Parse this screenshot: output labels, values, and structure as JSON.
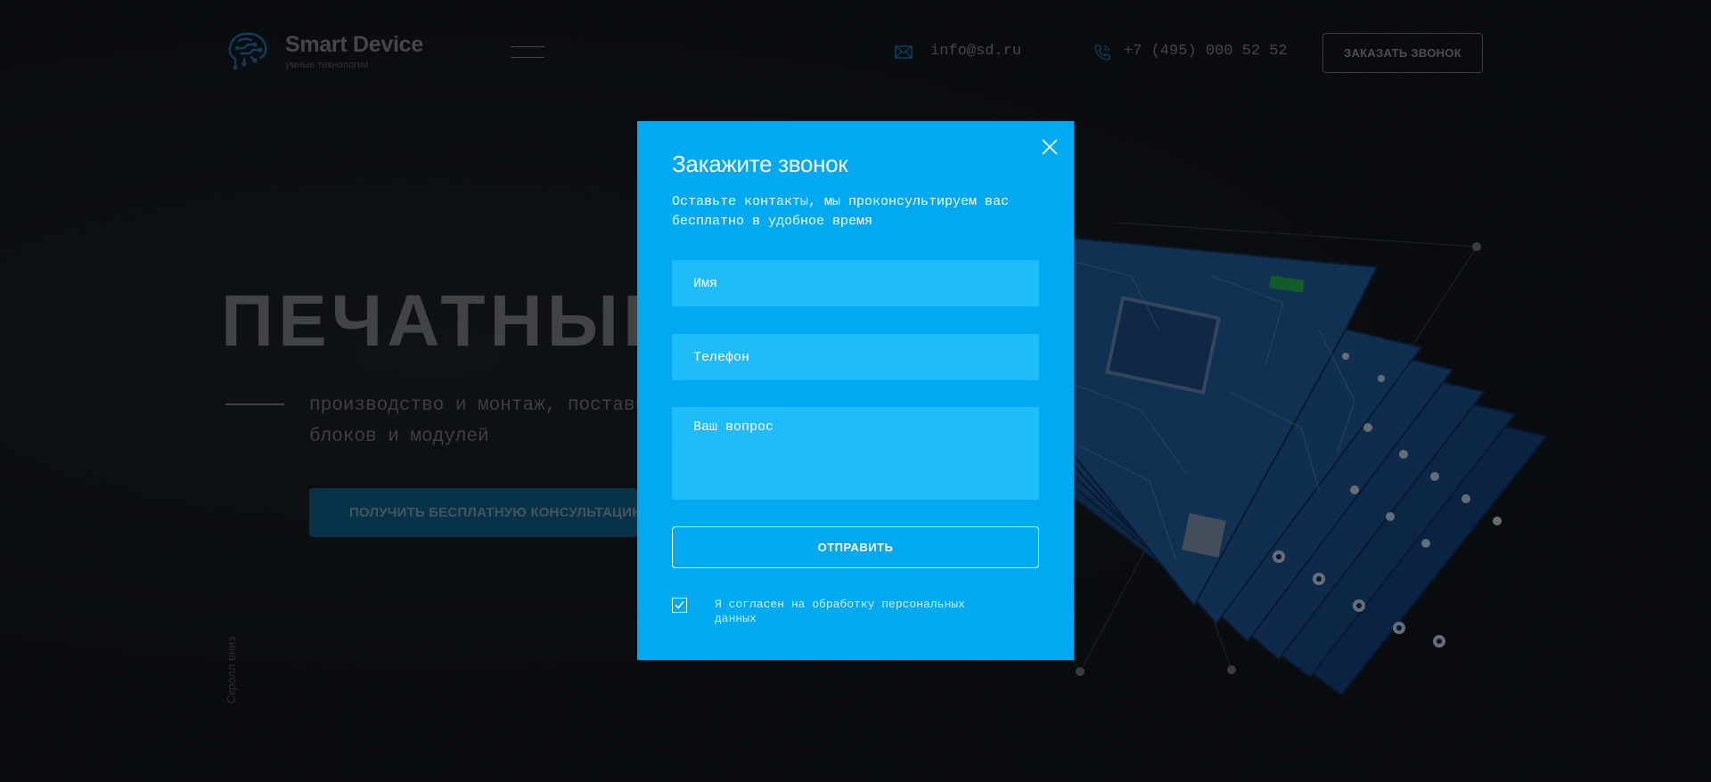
{
  "header": {
    "brand_name": "Smart Device",
    "brand_tagline": "умные технологии",
    "email": "info@sd.ru",
    "phone": "+7 (495) 000 52 52",
    "callback_label": "ЗАКАЗАТЬ ЗВОНОК",
    "icons": {
      "logo": "brain-chip-logo",
      "menu": "burger-menu-icon",
      "email": "mail-icon",
      "phone": "phone-icon"
    }
  },
  "hero": {
    "title": "ПЕЧАТНЫЕ ПЛАТЫ",
    "subtitle_line1": "производство и монтаж, поставка электронных",
    "subtitle_line2": "блоков и модулей",
    "cta_label": "ПОЛУЧИТЬ БЕСПЛАТНУЮ КОНСУЛЬТАЦИЮ",
    "scroll_hint": "Скролл вниз"
  },
  "modal": {
    "title": "Закажите звонок",
    "text": "Оставьте контакты, мы проконсультируем вас бесплатно в удобное время",
    "name_placeholder": "Имя",
    "phone_placeholder": "Телефон",
    "question_placeholder": "Ваш вопрос",
    "submit_label": "ОТПРАВИТЬ",
    "consent_label": "Я согласен на обработку  персональных данных",
    "consent_checked": true,
    "icons": {
      "close": "close-icon",
      "consent": "checkbox-check-icon"
    }
  },
  "colors": {
    "page_bg": "#12171b",
    "modal_bg": "#00a9f0",
    "field_bg": "#1fbcfa",
    "cta_bg": "#0e5e86",
    "logo_blue": "#1a6ea5",
    "pcb_blue": "#1a4f8c"
  }
}
